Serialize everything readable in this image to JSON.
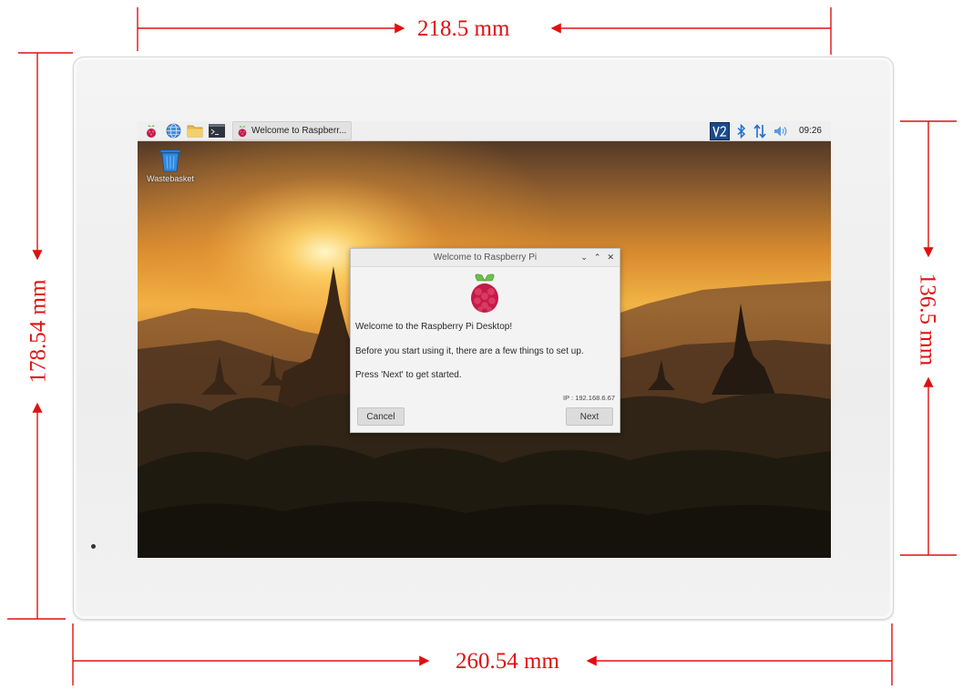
{
  "dimensions": {
    "top_width": "218.5 mm",
    "right_height": "136.5 mm",
    "left_height": "178.54 mm",
    "bottom_width": "260.54 mm"
  },
  "taskbar": {
    "task_label": "Welcome to Raspberr...",
    "clock": "09:26",
    "launchers": [
      "raspberry-menu-icon",
      "web-browser-icon",
      "file-manager-icon",
      "terminal-icon"
    ],
    "tray": [
      "vnc-icon",
      "bluetooth-icon",
      "network-icon",
      "volume-icon"
    ]
  },
  "desktop": {
    "wastebasket_label": "Wastebasket"
  },
  "dialog": {
    "title": "Welcome to Raspberry Pi",
    "line1": "Welcome to the Raspberry Pi Desktop!",
    "line2": "Before you start using it, there are a few things to set up.",
    "line3": "Press 'Next' to get started.",
    "ip": "IP : 192.168.6.67",
    "cancel_label": "Cancel",
    "next_label": "Next",
    "controls": [
      "chevron-down-icon",
      "chevron-up-icon",
      "close-icon"
    ]
  },
  "colors": {
    "dimension": "#e01010",
    "raspberry": "#c51a4a",
    "leaf": "#6cc04a",
    "vnc": "#1b4a8a",
    "bluetooth": "#1d6fd1"
  }
}
